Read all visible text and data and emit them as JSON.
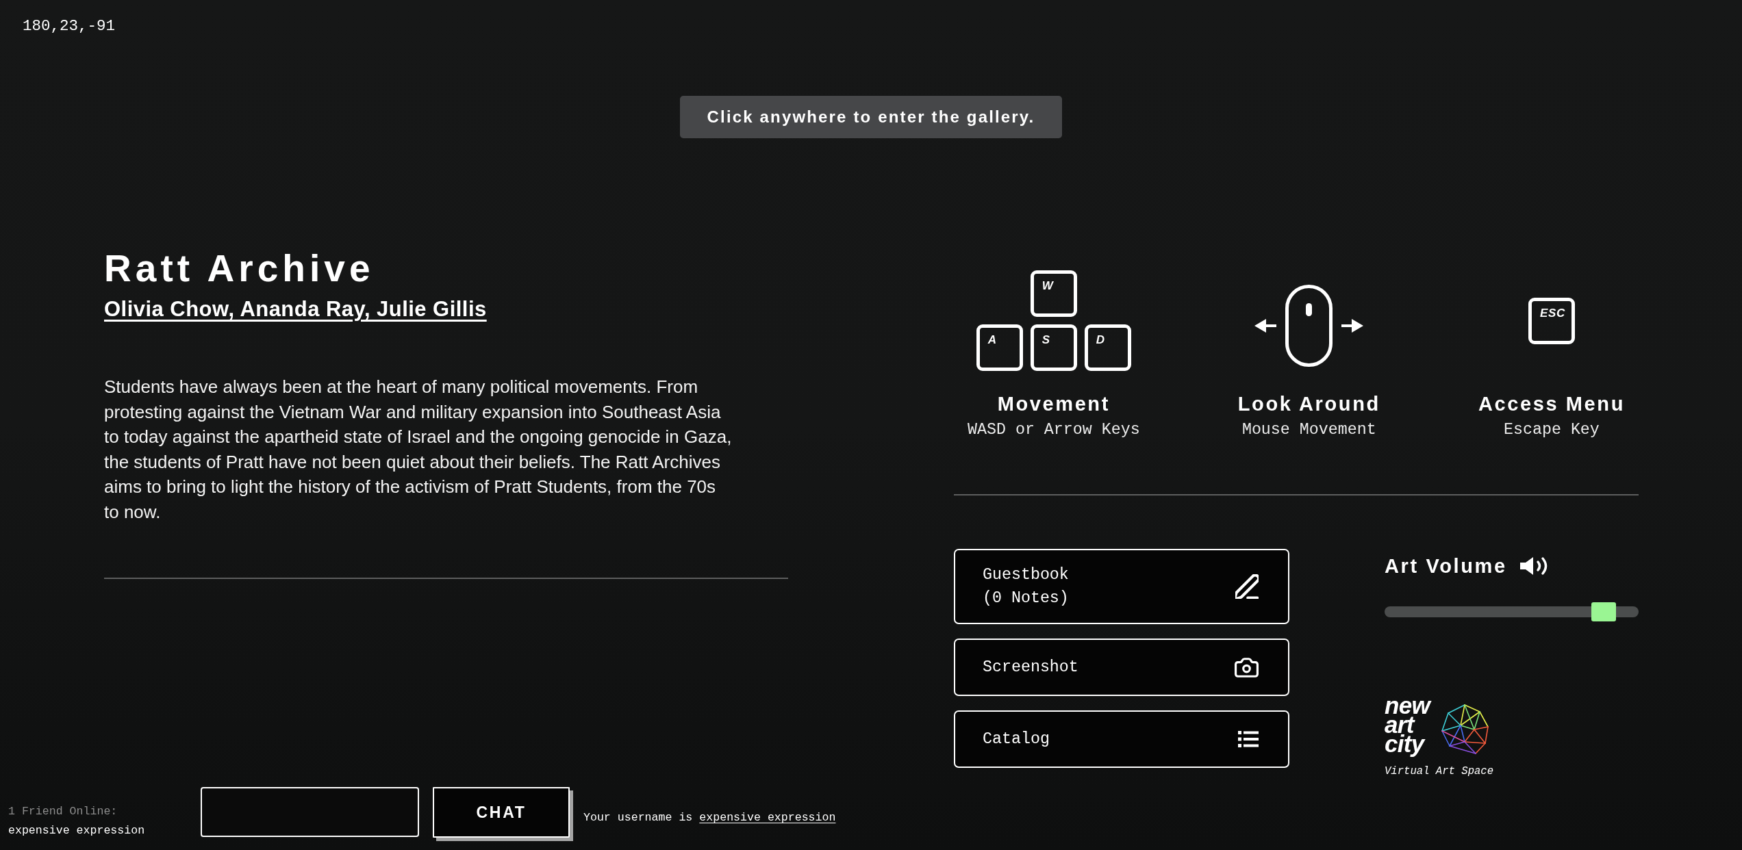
{
  "coordinates": "180,23,-91",
  "banner": {
    "text": "Click anywhere to enter the gallery."
  },
  "exhibit": {
    "title": "Ratt Archive",
    "authors": "Olivia Chow, Ananda Ray, Julie Gillis",
    "description": "Students have always been at the heart of many political movements. From protesting against the Vietnam War and military expansion into Southeast Asia to today against the apartheid state of Israel and the ongoing genocide in Gaza, the students of Pratt have not been quiet about their beliefs. The Ratt Archives aims to bring to light the history of the activism of Pratt Students, from the 70s to now."
  },
  "controls": [
    {
      "kind": "wasd",
      "keys": [
        "W",
        "A",
        "S",
        "D"
      ],
      "title": "Movement",
      "subtitle": "WASD or Arrow Keys"
    },
    {
      "kind": "mouse",
      "title": "Look Around",
      "subtitle": "Mouse Movement"
    },
    {
      "kind": "key",
      "keys": [
        "ESC"
      ],
      "title": "Access Menu",
      "subtitle": "Escape Key"
    }
  ],
  "actions": [
    {
      "kind": "guestbook",
      "label": "Guestbook",
      "detail": "(0 Notes)"
    },
    {
      "kind": "screenshot",
      "label": "Screenshot"
    },
    {
      "kind": "catalog",
      "label": "Catalog"
    }
  ],
  "volume": {
    "label": "Art Volume",
    "level": 0.9
  },
  "logo": {
    "wordmark": [
      "new",
      "art",
      "city"
    ],
    "tagline": "Virtual Art Space"
  },
  "friends": {
    "heading": "1 Friend Online:",
    "names": [
      "expensive expression"
    ]
  },
  "chat": {
    "button": "CHAT"
  },
  "username": {
    "prefix": "Your username is",
    "name": "expensive expression"
  }
}
